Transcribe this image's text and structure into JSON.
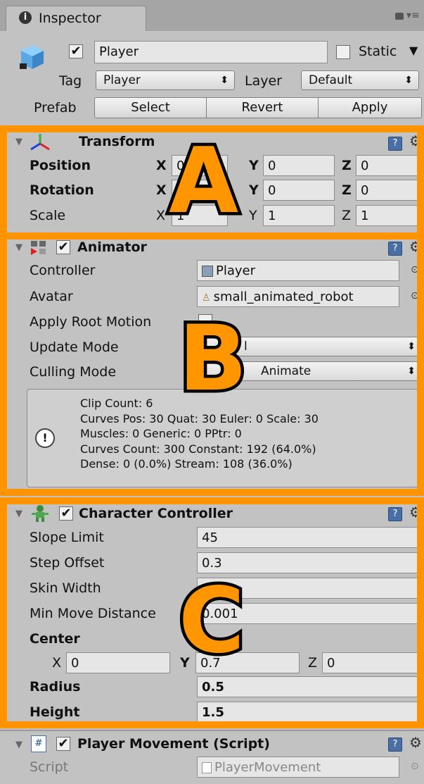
{
  "tab": {
    "title": "Inspector"
  },
  "header": {
    "name": "Player",
    "static_label": "Static",
    "tag_label": "Tag",
    "tag_value": "Player",
    "layer_label": "Layer",
    "layer_value": "Default",
    "prefab_label": "Prefab",
    "select_label": "Select",
    "revert_label": "Revert",
    "apply_label": "Apply"
  },
  "transform": {
    "title": "Transform",
    "position_label": "Position",
    "rotation_label": "Rotation",
    "scale_label": "Scale",
    "x": "X",
    "y": "Y",
    "z": "Z",
    "pos": [
      "0",
      "0",
      "0"
    ],
    "rot": [
      "0",
      "0",
      "0"
    ],
    "scale": [
      "1",
      "1",
      "1"
    ]
  },
  "animator": {
    "title": "Animator",
    "controller_label": "Controller",
    "controller_value": "Player",
    "avatar_label": "Avatar",
    "avatar_value": "small_animated_robot",
    "root_motion_label": "Apply Root Motion",
    "update_label": "Update Mode",
    "update_value": "l",
    "culling_label": "Culling Mode",
    "culling_value": "Animate",
    "info": [
      "Clip Count: 6",
      "Curves Pos: 30 Quat: 30 Euler: 0 Scale: 30",
      "Muscles: 0 Generic: 0 PPtr: 0",
      "Curves Count: 300 Constant: 192 (64.0%)",
      "Dense: 0 (0.0%) Stream: 108 (36.0%)"
    ]
  },
  "cc": {
    "title": "Character Controller",
    "slope_label": "Slope Limit",
    "slope_value": "45",
    "step_label": "Step Offset",
    "step_value": "0.3",
    "skin_label": "Skin Width",
    "skin_value": "",
    "minmove_label": "Min Move Distance",
    "minmove_value": "0.001",
    "center_label": "Center",
    "cx": "0",
    "cy": "0.7",
    "cz": "0",
    "radius_label": "Radius",
    "radius_value": "0.5",
    "height_label": "Height",
    "height_value": "1.5"
  },
  "script": {
    "title": "Player Movement (Script)",
    "script_label": "Script",
    "script_value": "PlayerMovement"
  },
  "callouts": {
    "a": "A",
    "b": "B",
    "c": "C"
  },
  "colors": {
    "highlight": "#ff9300",
    "panel": "#c2c2c2",
    "tabbar": "#a5a5a5"
  }
}
